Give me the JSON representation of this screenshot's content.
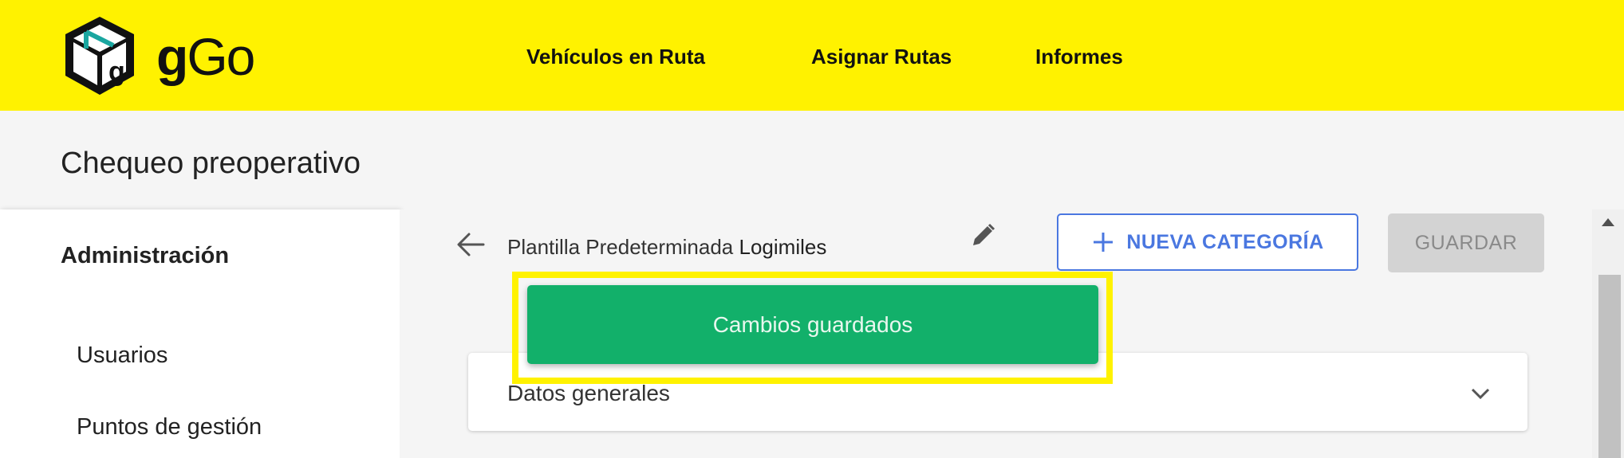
{
  "header": {
    "logo_text_bold": "g",
    "logo_text_light": "Go",
    "nav": [
      {
        "label": "Vehículos en Ruta"
      },
      {
        "label": "Asignar Rutas"
      },
      {
        "label": "Informes"
      }
    ]
  },
  "page_title": "Chequeo preoperativo",
  "sidebar": {
    "heading": "Administración",
    "items": [
      {
        "label": "Usuarios"
      },
      {
        "label": "Puntos de gestión"
      }
    ]
  },
  "template": {
    "name": "Plantilla Predeterminada",
    "company": "Logimiles"
  },
  "buttons": {
    "new_category": "NUEVA CATEGORÍA",
    "save": "GUARDAR"
  },
  "toast": {
    "message": "Cambios guardados"
  },
  "sections": [
    {
      "title": "Datos generales"
    }
  ],
  "colors": {
    "brand_yellow": "#fff200",
    "accent_blue": "#4a77e0",
    "success_green": "#12b06a",
    "logo_teal": "#1aa6a0"
  },
  "icons": {
    "back": "arrow-left-icon",
    "edit": "pencil-icon",
    "add": "plus-icon",
    "expand": "chevron-down-icon"
  }
}
